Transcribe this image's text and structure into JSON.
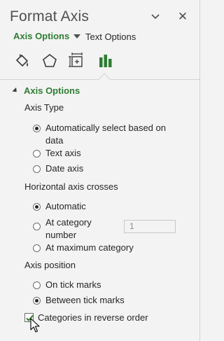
{
  "pane": {
    "title": "Format Axis",
    "close_glyph": "✕",
    "dropdown_icon": "chevron-down-icon"
  },
  "tabs": {
    "axis_options": "Axis Options",
    "text_options": "Text Options"
  },
  "icons": [
    "fill-line-icon",
    "effects-pentagon-icon",
    "size-properties-icon",
    "axis-options-chart-icon"
  ],
  "accent_color": "#2e7d32",
  "section": {
    "title": "Axis Options",
    "axis_type_label": "Axis Type",
    "axis_type_options": [
      {
        "line1": "Automatically select based on",
        "line2": "data",
        "selected": true
      },
      {
        "label": "Text axis",
        "selected": false
      },
      {
        "label": "Date axis",
        "selected": false
      }
    ],
    "crosses_label": "Horizontal axis crosses",
    "crosses_options": [
      {
        "label": "Automatic",
        "selected": true
      },
      {
        "line1": "At category",
        "line2": "number",
        "selected": false
      },
      {
        "label": "At maximum category",
        "selected": false
      }
    ],
    "category_number_value": "1",
    "position_label": "Axis position",
    "position_options": [
      {
        "label": "On tick marks",
        "selected": false
      },
      {
        "label": "Between tick marks",
        "selected": true
      }
    ],
    "reverse_order_label": "Categories in reverse order",
    "reverse_order_checked": true
  }
}
